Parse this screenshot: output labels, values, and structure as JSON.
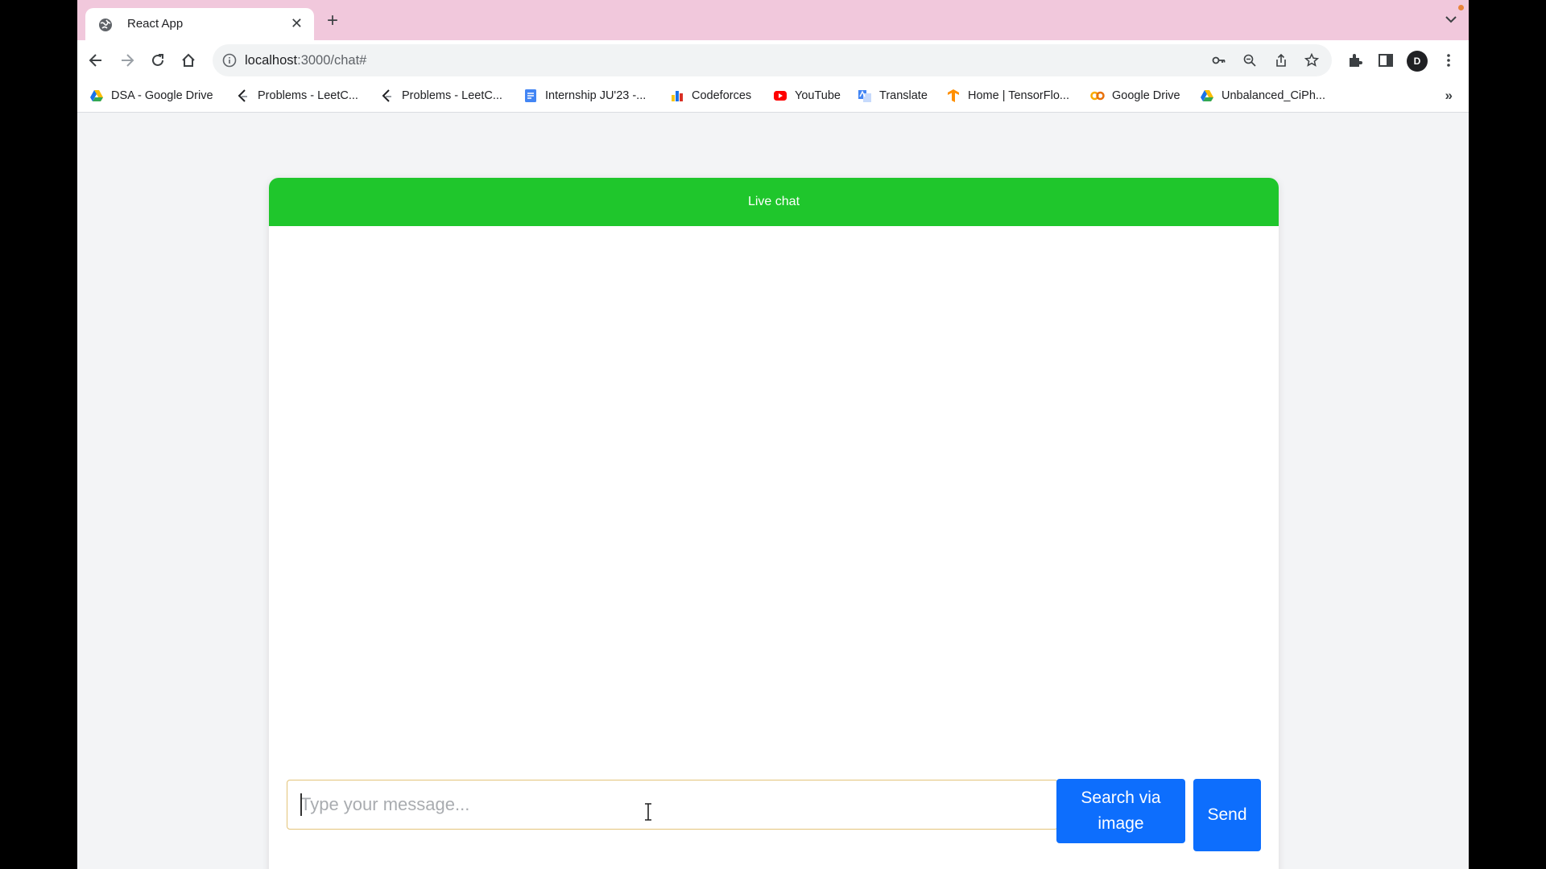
{
  "browser": {
    "tab": {
      "title": "React App",
      "favicon": "globe-icon",
      "close_label": "✕"
    },
    "new_tab_label": "+",
    "url": {
      "host": "localhost",
      "rest": ":3000/chat#"
    },
    "profile_initials": "D",
    "bookmarks": [
      {
        "label": "DSA - Google Drive",
        "icon": "google-drive-icon"
      },
      {
        "label": "Problems - LeetC...",
        "icon": "leetcode-icon"
      },
      {
        "label": "Problems - LeetC...",
        "icon": "leetcode-icon"
      },
      {
        "label": "Internship JU'23 -...",
        "icon": "google-docs-icon"
      },
      {
        "label": "Codeforces",
        "icon": "codeforces-icon"
      },
      {
        "label": "YouTube",
        "icon": "youtube-icon"
      },
      {
        "label": "Translate",
        "icon": "translate-icon"
      },
      {
        "label": "Home | TensorFlo...",
        "icon": "tensorflow-icon"
      },
      {
        "label": "Google Drive",
        "icon": "colab-icon"
      },
      {
        "label": "Unbalanced_CiPh...",
        "icon": "google-drive-icon"
      }
    ],
    "bookmarks_more": "»"
  },
  "chat": {
    "header_title": "Live chat",
    "header_color": "#1fc62c",
    "input_placeholder": "Type your message...",
    "input_value": "",
    "search_image_label": "Search via image",
    "send_label": "Send",
    "button_color": "#0d6efd"
  }
}
